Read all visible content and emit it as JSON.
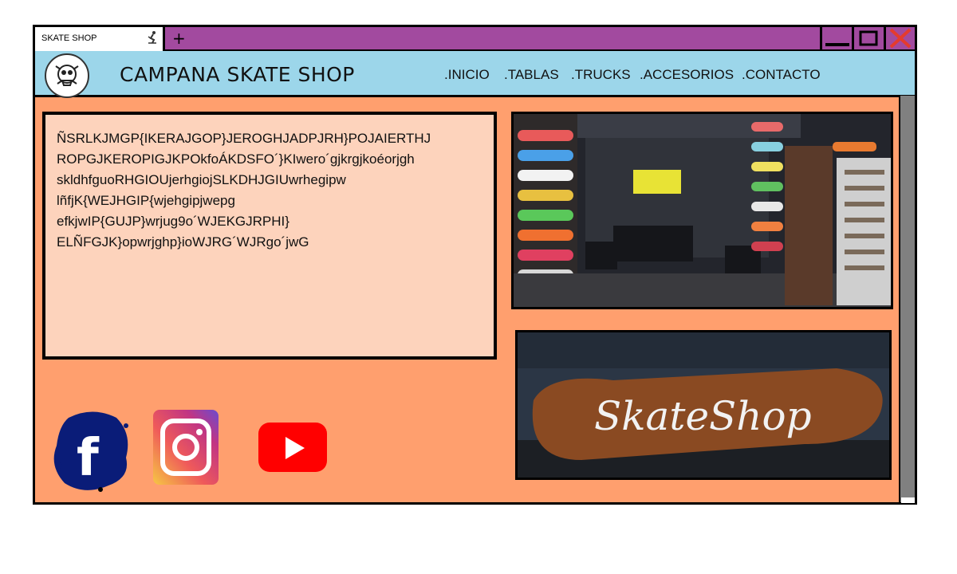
{
  "tab": {
    "title": "SKATE SHOP",
    "new_tab_label": "+"
  },
  "window_controls": {
    "minimize_icon": "minimize-icon",
    "maximize_icon": "maximize-icon",
    "close_icon": "close-icon"
  },
  "header": {
    "title": "CAMPANA SKATE SHOP",
    "nav": [
      ".INICIO",
      ".TABLAS",
      ".TRUCKS",
      ".ACCESORIOS",
      ".CONTACTO"
    ]
  },
  "main": {
    "text_lines": [
      "ÑSRLKJMGP{IKERAJGOP}JEROGHJADPJRH}POJAIERTHJ",
      "ROPGJKEROPIGJKPOkfoÁKDSFO´}KIwero´gjkrgjkoéorjgh",
      "skldhfguoRHGIOUjerhgiojSLKDHJGIUwrhegipw",
      "lñfjK{WEJHGIP{wjehgipjwepg",
      "efkjwIP{GUJP}wrjug9o´WJEKGJRPHI}",
      "ELÑFGJK}opwrjghp}ioWJRG´WJRgo´jwG"
    ],
    "photo2_caption": "SkateShop"
  },
  "social": [
    "facebook-icon",
    "instagram-icon",
    "youtube-icon"
  ],
  "colors": {
    "tabbar": "#a24a9f",
    "header": "#9cd6ea",
    "background": "#ff9f6e",
    "textbox": "#fdd3bc",
    "close": "#e53b2e",
    "nav_accent": "#e88b20"
  }
}
